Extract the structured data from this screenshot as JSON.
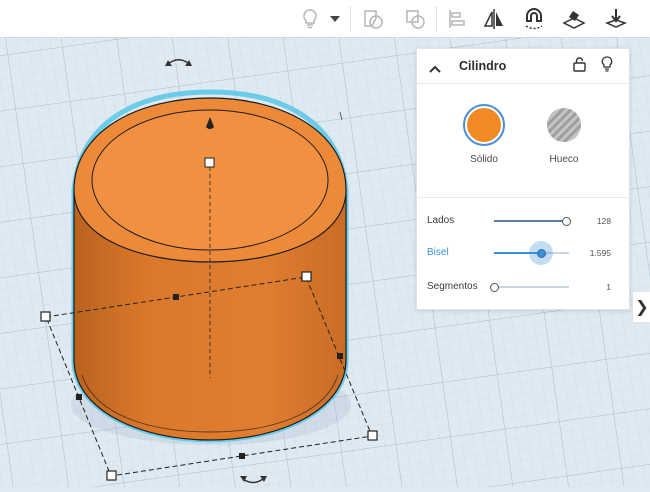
{
  "toolbar": {
    "buttons": [
      {
        "name": "light-bulb-icon"
      },
      {
        "name": "dropdown-caret-icon"
      },
      {
        "name": "group-icon"
      },
      {
        "name": "ungroup-icon"
      },
      {
        "name": "align-icon"
      },
      {
        "name": "mirror-icon"
      },
      {
        "name": "cruise-magnet-icon"
      },
      {
        "name": "workplane-icon"
      },
      {
        "name": "drop-to-plane-icon"
      }
    ]
  },
  "inspector": {
    "title": "Cilindro",
    "solid_label": "Sólido",
    "hole_label": "Hueco",
    "colors": {
      "solid": "#f08a24",
      "hole": "#bdbdbd",
      "accent": "#3a8fd8"
    },
    "params": [
      {
        "label": "Lados",
        "value": "128",
        "level": 0.96,
        "active": false
      },
      {
        "label": "Bisel",
        "value": "1.595",
        "level": 0.63,
        "active": true
      },
      {
        "label": "Segmentos",
        "value": "1",
        "level": 0.0,
        "active": false
      }
    ]
  },
  "side_toggle": "❯",
  "colors": {
    "shape_body": "#d9762b",
    "shape_top": "#f19041",
    "shape_outline": "#1d1d1d",
    "selection_glow": "#58c7e6",
    "grid_bg": "#dfe9f1",
    "grid_minor": "#c7d6e4",
    "grid_major": "#a9bfd4"
  }
}
